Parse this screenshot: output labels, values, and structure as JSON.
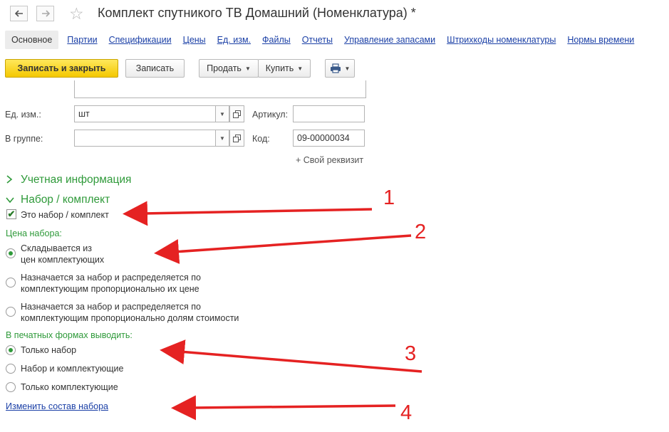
{
  "window": {
    "title": "Комплект спутникого ТВ Домашний (Номенклатура) *",
    "back_icon": "arrow-left",
    "forward_icon": "arrow-right",
    "favorite_icon": "star-outline"
  },
  "tabs": [
    {
      "label": "Основное",
      "active": true
    },
    {
      "label": "Партии"
    },
    {
      "label": "Спецификации"
    },
    {
      "label": "Цены"
    },
    {
      "label": "Ед. изм."
    },
    {
      "label": "Файлы"
    },
    {
      "label": "Отчеты"
    },
    {
      "label": "Управление запасами"
    },
    {
      "label": "Штрихкоды номенклатуры"
    },
    {
      "label": "Нормы времени"
    }
  ],
  "toolbar": {
    "save_close": "Записать и закрыть",
    "save": "Записать",
    "sell": "Продать",
    "buy": "Купить",
    "print_icon": "printer"
  },
  "form": {
    "unit_label": "Ед. изм.:",
    "unit_value": "шт",
    "group_label": "В группе:",
    "group_value": "",
    "article_label": "Артикул:",
    "article_value": "",
    "code_label": "Код:",
    "code_value": "09-00000034",
    "add_prop": "+ Свой реквизит"
  },
  "sections": {
    "accounting": "Учетная информация",
    "kit": "Набор / комплект"
  },
  "kit": {
    "is_kit_label": "Это набор / комплект",
    "is_kit_checked": true,
    "price_label": "Цена набора:",
    "price_options": [
      {
        "line1": "Складывается из",
        "line2": "цен комплектующих",
        "selected": true
      },
      {
        "line1": "Назначается за набор и распределяется по",
        "line2": "комплектующим пропорционально их цене",
        "selected": false
      },
      {
        "line1": "Назначается за набор и распределяется по",
        "line2": "комплектующим пропорционально долям стоимости",
        "selected": false
      }
    ],
    "print_label": "В печатных формах выводить:",
    "print_options": [
      {
        "label": "Только набор",
        "selected": true
      },
      {
        "label": "Набор и комплектующие",
        "selected": false
      },
      {
        "label": "Только комплектующие",
        "selected": false
      }
    ],
    "change_link": "Изменить состав набора"
  },
  "annotations": {
    "color": "#e52222",
    "numbers": [
      "1",
      "2",
      "3",
      "4"
    ]
  }
}
